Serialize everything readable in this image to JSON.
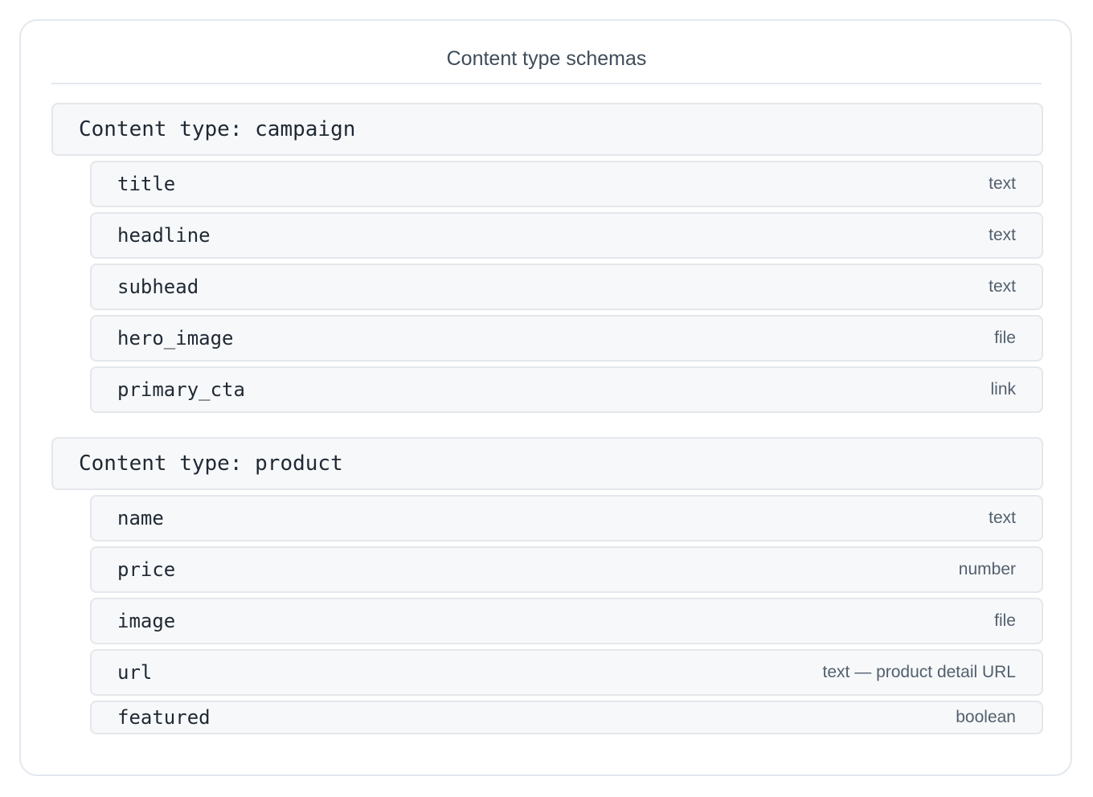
{
  "panel": {
    "title": "Content type schemas"
  },
  "content_types": [
    {
      "header": "Content type: campaign",
      "fields": [
        {
          "name": "title",
          "type": "text"
        },
        {
          "name": "headline",
          "type": "text"
        },
        {
          "name": "subhead",
          "type": "text"
        },
        {
          "name": "hero_image",
          "type": "file"
        },
        {
          "name": "primary_cta",
          "type": "link"
        }
      ]
    },
    {
      "header": "Content type: product",
      "fields": [
        {
          "name": "name",
          "type": "text"
        },
        {
          "name": "price",
          "type": "number"
        },
        {
          "name": "image",
          "type": "file"
        },
        {
          "name": "url",
          "type": "text — product detail URL"
        },
        {
          "name": "featured",
          "type": "boolean"
        }
      ]
    }
  ]
}
